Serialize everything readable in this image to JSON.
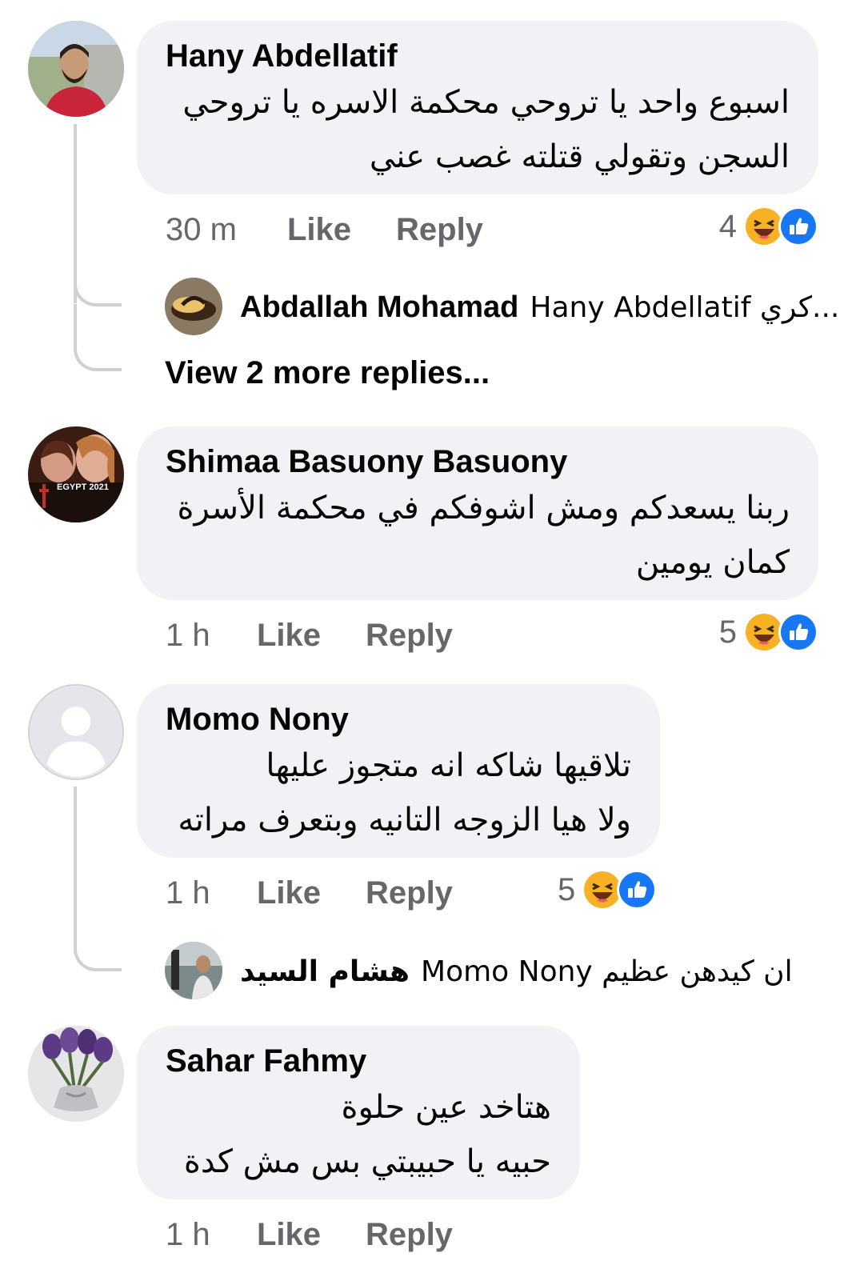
{
  "actions": {
    "like": "Like",
    "reply": "Reply"
  },
  "comments": [
    {
      "author": "Hany Abdellatif",
      "lines": [
        "اسبوع واحد يا تروحي محكمة الاسره يا تروحي",
        "السجن وتقولي قتلته غصب عني"
      ],
      "time": "30 m",
      "reactions": "4",
      "reply": {
        "author": "Abdallah Mohamad",
        "text": "Hany Abdellatif كري..."
      },
      "view_more": "View 2 more replies..."
    },
    {
      "author": "Shimaa Basuony Basuony",
      "avatar_caption": "EGYPT 2021",
      "lines": [
        "ربنا يسعدكم ومش اشوفكم في محكمة الأسرة",
        "كمان يومين"
      ],
      "time": "1 h",
      "reactions": "5"
    },
    {
      "author": "Momo Nony",
      "lines": [
        "تلاقيها شاكه انه متجوز عليها",
        "ولا هيا الزوجه التانيه وبتعرف مراته"
      ],
      "time": "1 h",
      "reactions": "5",
      "reply": {
        "author": "هشام السيد",
        "text": "Momo Nony ان كيدهن عظيم"
      }
    },
    {
      "author": "Sahar Fahmy",
      "lines": [
        "هتاخد عين حلوة",
        "حبيه يا حبيبتي بس مش كدة"
      ],
      "time": "1 h"
    }
  ],
  "colors": {
    "bubble": "#f0f2f5",
    "meta_text": "#65676b",
    "thread_line": "#ced0d4",
    "like_blue": "#1877f2",
    "haha_yellow": "#f7b125"
  },
  "icons": [
    "haha-reaction-icon",
    "like-reaction-icon",
    "default-avatar-icon"
  ]
}
